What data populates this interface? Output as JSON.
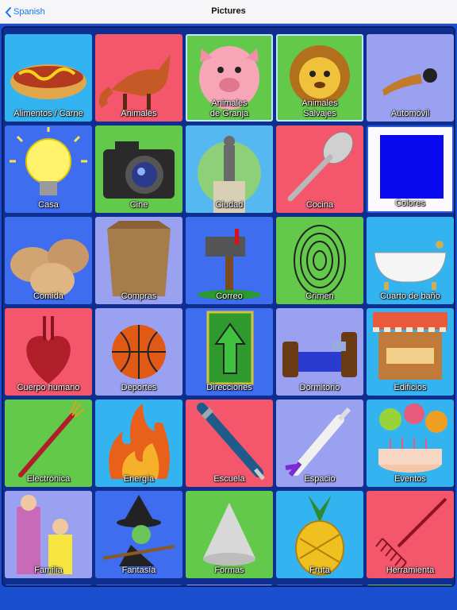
{
  "nav": {
    "back_label": "Spanish",
    "title": "Pictures"
  },
  "tiles": [
    {
      "label": "Alimentos / Carne",
      "icon": "hotdog-icon",
      "color": "#33b4f0"
    },
    {
      "label": "Animales",
      "icon": "fox-icon",
      "color": "#f4566b"
    },
    {
      "label": "Animales\nde Granja",
      "icon": "pig-icon",
      "color": "#63c94a"
    },
    {
      "label": "Animales\nSalvajes",
      "icon": "lion-icon",
      "color": "#63c94a"
    },
    {
      "label": "Automóvil",
      "icon": "horn-icon",
      "color": "#9aa1f0"
    },
    {
      "label": "Casa",
      "icon": "lightbulb-icon",
      "color": "#3f6df0"
    },
    {
      "label": "Cine",
      "icon": "camera-icon",
      "color": "#63c94a"
    },
    {
      "label": "Ciudad",
      "icon": "statue-icon",
      "color": "#33b4f0"
    },
    {
      "label": "Cocina",
      "icon": "spoon-icon",
      "color": "#f4566b"
    },
    {
      "label": "Colores",
      "icon": "blue-square-icon",
      "color": "#fbfbff"
    },
    {
      "label": "Comida",
      "icon": "eggs-icon",
      "color": "#3f6df0"
    },
    {
      "label": "Compras",
      "icon": "paper-bag-icon",
      "color": "#9aa1f0"
    },
    {
      "label": "Correo",
      "icon": "mailbox-icon",
      "color": "#3f6df0"
    },
    {
      "label": "Crimen",
      "icon": "fingerprint-icon",
      "color": "#63c94a"
    },
    {
      "label": "Cuarto de baño",
      "icon": "bathtub-icon",
      "color": "#33b4f0"
    },
    {
      "label": "Cuerpo humano",
      "icon": "heart-icon",
      "color": "#f4566b"
    },
    {
      "label": "Deportes",
      "icon": "basketball-icon",
      "color": "#9aa1f0"
    },
    {
      "label": "Direcciones",
      "icon": "arrow-sign-icon",
      "color": "#3f6df0"
    },
    {
      "label": "Dormitorio",
      "icon": "bed-icon",
      "color": "#9aa1f0"
    },
    {
      "label": "Edificios",
      "icon": "market-stall-icon",
      "color": "#33b4f0"
    },
    {
      "label": "Electrónica",
      "icon": "cable-icon",
      "color": "#63c94a"
    },
    {
      "label": "Energía",
      "icon": "fire-icon",
      "color": "#33b4f0"
    },
    {
      "label": "Escuela",
      "icon": "pen-icon",
      "color": "#f4566b"
    },
    {
      "label": "Espacio",
      "icon": "rocket-icon",
      "color": "#9aa1f0"
    },
    {
      "label": "Eventos",
      "icon": "cake-balloons-icon",
      "color": "#33b4f0"
    },
    {
      "label": "Familia",
      "icon": "family-icon",
      "color": "#9aa1f0"
    },
    {
      "label": "Fantasía",
      "icon": "witch-icon",
      "color": "#3f6df0"
    },
    {
      "label": "Formas",
      "icon": "cone-icon",
      "color": "#63c94a"
    },
    {
      "label": "Fruta",
      "icon": "pineapple-icon",
      "color": "#33b4f0"
    },
    {
      "label": "Herramienta",
      "icon": "rake-icon",
      "color": "#f4566b"
    }
  ]
}
